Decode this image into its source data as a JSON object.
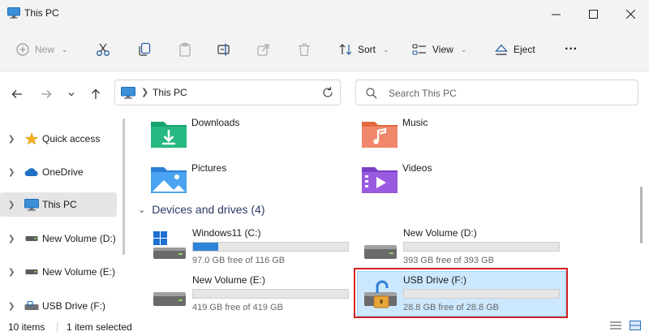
{
  "window": {
    "title": "This PC"
  },
  "toolbar": {
    "new_label": "New",
    "sort_label": "Sort",
    "view_label": "View",
    "eject_label": "Eject",
    "more_label": "···"
  },
  "address": {
    "crumb": "This PC"
  },
  "search": {
    "placeholder": "Search This PC"
  },
  "sidebar": {
    "items": [
      {
        "label": "Quick access",
        "icon": "star-icon"
      },
      {
        "label": "OneDrive",
        "icon": "cloud-icon"
      },
      {
        "label": "This PC",
        "icon": "pc-icon",
        "selected": true
      },
      {
        "label": "New Volume (D:)",
        "icon": "drive-icon"
      },
      {
        "label": "New Volume (E:)",
        "icon": "drive-icon"
      },
      {
        "label": "USB Drive (F:)",
        "icon": "usb-drive-icon"
      }
    ]
  },
  "folders": [
    {
      "name": "Downloads",
      "icon": "downloads-folder-icon"
    },
    {
      "name": "Music",
      "icon": "music-folder-icon"
    },
    {
      "name": "Pictures",
      "icon": "pictures-folder-icon"
    },
    {
      "name": "Videos",
      "icon": "videos-folder-icon"
    }
  ],
  "devices": {
    "heading": "Devices and drives (4)",
    "drives": [
      {
        "name": "Windows11 (C:)",
        "free": "97.0 GB free of 116 GB",
        "used_fraction": 0.16
      },
      {
        "name": "New Volume (D:)",
        "free": "393 GB free of 393 GB",
        "used_fraction": 0.0
      },
      {
        "name": "New Volume (E:)",
        "free": "419 GB free of 419 GB",
        "used_fraction": 0.0
      },
      {
        "name": "USB Drive (F:)",
        "free": "28.8 GB free of 28.8 GB",
        "used_fraction": 0.0,
        "selected": true
      }
    ]
  },
  "status": {
    "count": "10 items",
    "selection": "1 item selected"
  },
  "colors": {
    "accent": "#2c84d8",
    "selection": "#cce8ff",
    "highlight": "#d22020"
  }
}
